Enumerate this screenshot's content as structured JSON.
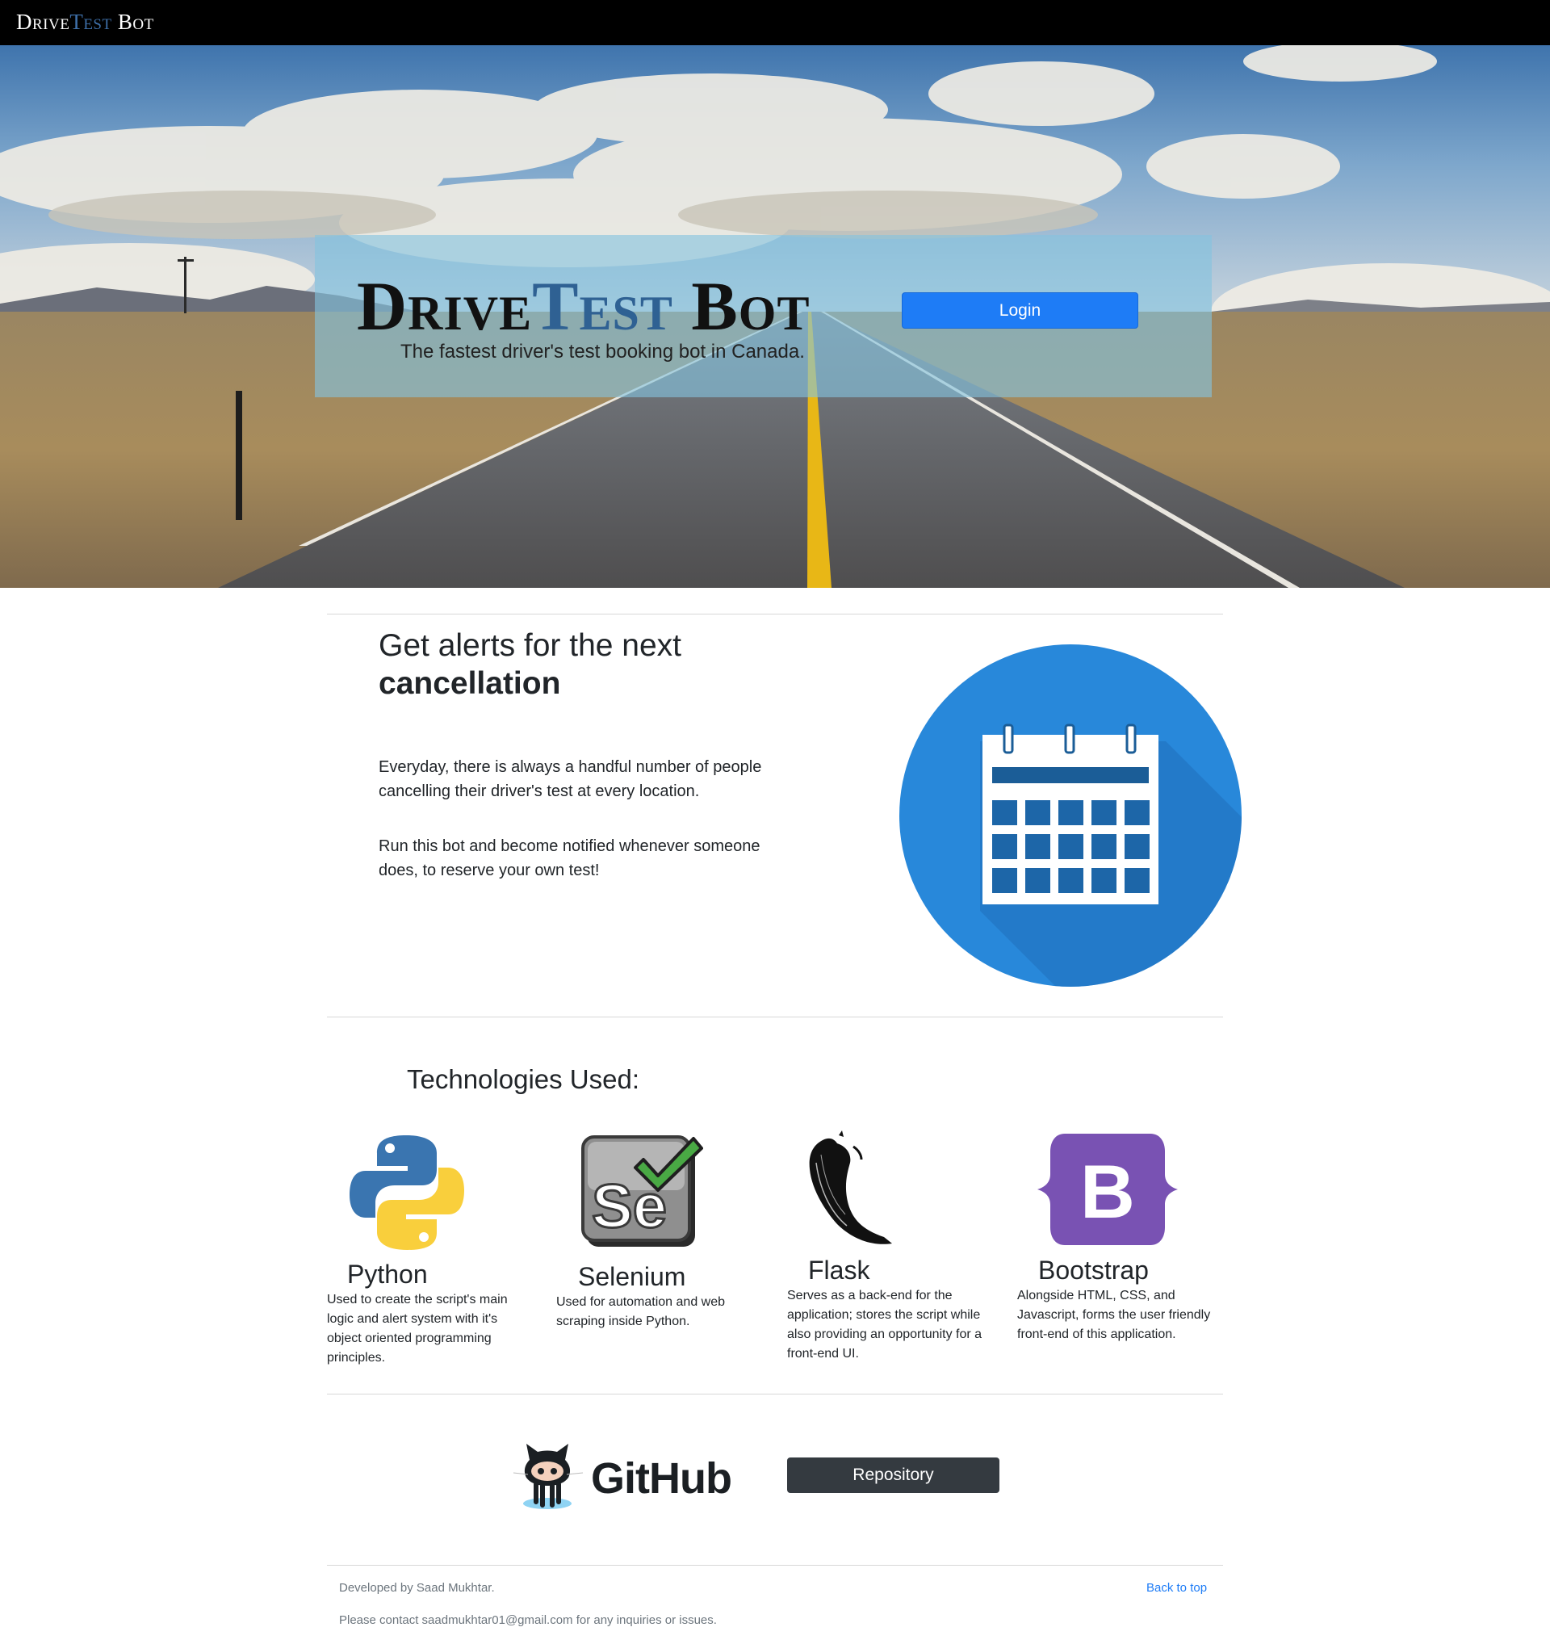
{
  "navbar": {
    "brand_part1": "Drive",
    "brand_part2": "Test",
    "brand_part3": " Bot"
  },
  "hero": {
    "title_part1": "Drive",
    "title_part2": "Test",
    "title_part3": " Bot",
    "subtitle": "The fastest driver's test booking bot in Canada.",
    "login_label": "Login"
  },
  "alerts": {
    "heading_line1": "Get alerts for the next",
    "heading_line2": "cancellation",
    "paragraph1": "Everyday, there is always a handful number of people cancelling their driver's test at every location.",
    "paragraph2": "Run this bot and become notified whenever someone does, to reserve your own test!",
    "image_icon": "calendar-icon"
  },
  "technologies": {
    "heading": "Technologies Used:",
    "items": [
      {
        "name": "Python",
        "icon": "python-logo-icon",
        "description": "Used to create the script's main logic and alert system with it's object oriented programming principles."
      },
      {
        "name": "Selenium",
        "icon": "selenium-logo-icon",
        "description": "Used for automation and web scraping inside Python."
      },
      {
        "name": "Flask",
        "icon": "flask-logo-icon",
        "description": "Serves as a back-end for the application; stores the script while also providing an opportunity for a front-end UI."
      },
      {
        "name": "Bootstrap",
        "icon": "bootstrap-logo-icon",
        "description": "Alongside HTML, CSS, and Javascript, forms the user friendly front-end of this application."
      }
    ]
  },
  "github": {
    "wordmark": "GitHub",
    "icon": "octocat-icon",
    "repo_label": "Repository"
  },
  "footer": {
    "developed_by": "Developed by Saad Mukhtar.",
    "contact": "Please contact saadmukhtar01@gmail.com for any inquiries or issues.",
    "back_to_top": "Back to top"
  },
  "colors": {
    "navbar_bg": "#000000",
    "primary": "#1e7cf6",
    "dark_button": "#343a40",
    "hero_box": "#84c4de",
    "calendar_blue": "#2888da",
    "bootstrap_purple": "#7952b3"
  }
}
